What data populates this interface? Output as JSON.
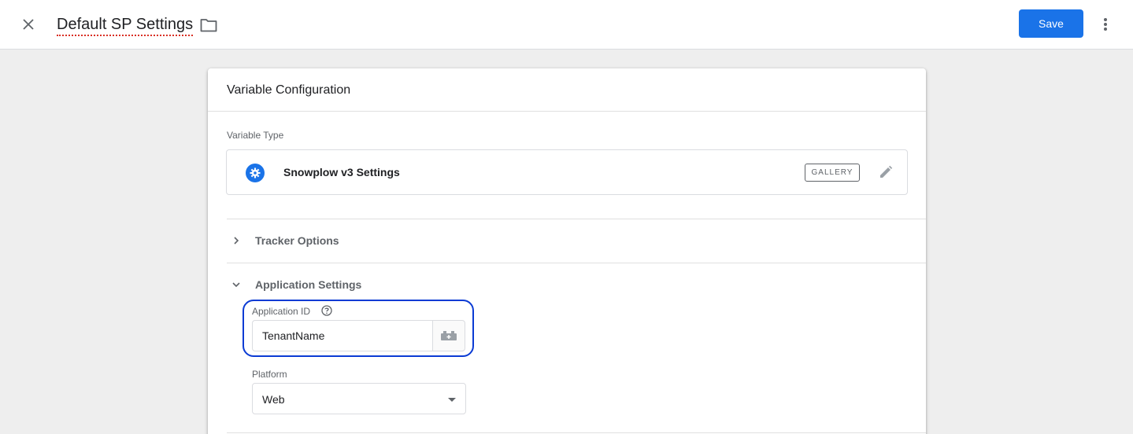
{
  "header": {
    "title": "Default SP Settings",
    "save_label": "Save",
    "icons": {
      "close": "close-icon",
      "folder": "folder-icon",
      "more": "more-vert-icon"
    }
  },
  "card": {
    "title": "Variable Configuration",
    "variable_type": {
      "label": "Variable Type",
      "name": "Snowplow v3 Settings",
      "badge": "GALLERY",
      "icon": "gear-icon"
    },
    "sections": [
      {
        "label": "Tracker Options",
        "expanded": false
      },
      {
        "label": "Application Settings",
        "expanded": true
      }
    ],
    "fields": {
      "application_id": {
        "label": "Application ID",
        "value": "TenantName"
      },
      "platform": {
        "label": "Platform",
        "value": "Web"
      }
    }
  },
  "colors": {
    "accent": "#1a73e8",
    "highlight": "#0b3bd4"
  }
}
